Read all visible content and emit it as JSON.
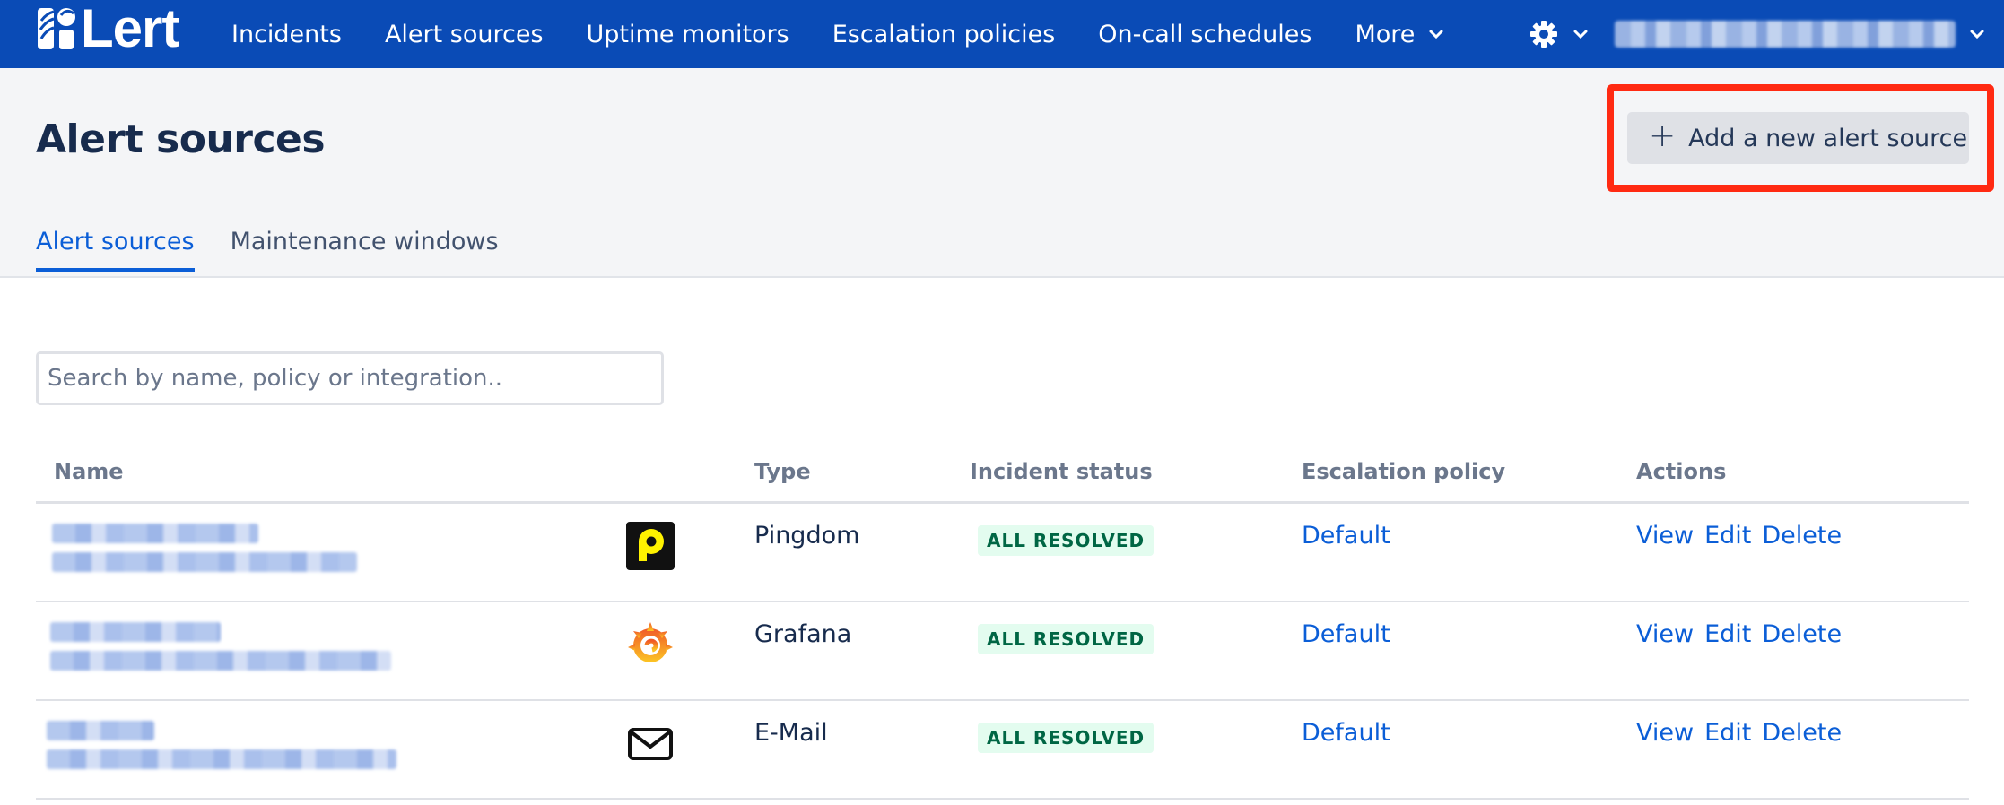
{
  "nav": {
    "logo_text": "Lert",
    "items": [
      "Incidents",
      "Alert sources",
      "Uptime monitors",
      "Escalation policies",
      "On-call schedules"
    ],
    "more_label": "More"
  },
  "page": {
    "title": "Alert sources",
    "add_button_label": "Add a new alert source"
  },
  "tabs": [
    "Alert sources",
    "Maintenance windows"
  ],
  "search": {
    "placeholder": "Search by name, policy or integration.."
  },
  "table": {
    "columns": [
      "Name",
      "Type",
      "Incident status",
      "Escalation policy",
      "Actions"
    ],
    "rows": [
      {
        "type": "Pingdom",
        "status": "ALL RESOLVED",
        "policy": "Default",
        "icon": "pingdom-icon"
      },
      {
        "type": "Grafana",
        "status": "ALL RESOLVED",
        "policy": "Default",
        "icon": "grafana-icon"
      },
      {
        "type": "E-Mail",
        "status": "ALL RESOLVED",
        "policy": "Default",
        "icon": "email-icon"
      }
    ],
    "actions": [
      "View",
      "Edit",
      "Delete"
    ]
  },
  "colors": {
    "nav_bg": "#0a4bb6",
    "link": "#0b5ed7",
    "badge_bg": "#e3fcef",
    "badge_text": "#006644",
    "highlight": "#ff2a12"
  }
}
